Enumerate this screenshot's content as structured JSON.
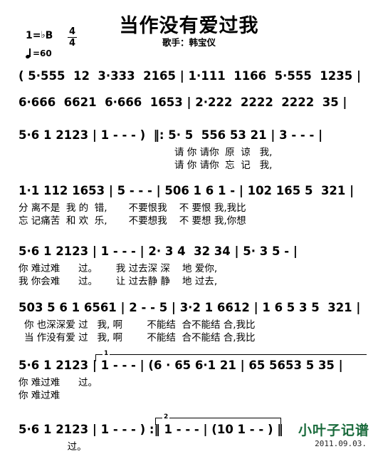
{
  "header": {
    "title": "当作没有爱过我",
    "artist": "歌手：韩宝仪",
    "key_label": "1=",
    "key_flat": "♭",
    "key_note": "B",
    "time_numerator": "4",
    "time_denominator": "4",
    "tempo": "=60"
  },
  "footer": {
    "credit": "小叶子记谱",
    "date": "2011.09.03.",
    "credit_color": "#1a6b3c"
  },
  "endings": {
    "first": "1",
    "second": "2"
  },
  "score": {
    "lines": [
      {
        "id": "line-1",
        "notes": "( 5·555  12  3·333  2165 | 1·111  1166  5·555  1235 |",
        "lyrics_a": "",
        "lyrics_b": ""
      },
      {
        "id": "line-2",
        "notes": "6·666  6621  6·666  1653 | 2·222  2222  2222  35 |",
        "lyrics_a": "",
        "lyrics_b": ""
      },
      {
        "id": "line-3",
        "notes": "5·6 1 2123 | 1 - - - )  ‖: 5· 5  556 53 21 | 3 - - - |",
        "lyrics_a": "请 你 请你  原  谅   我,",
        "lyrics_b": "请 你 请你  忘  记   我,"
      },
      {
        "id": "line-4",
        "notes": "1·1 112 1653 | 5 - - - | 506 1 6 1 - | 102 165 5  321 |",
        "lyrics_a": "分 离不是  我 的  错,       不要恨我    不 要恨 我,我比",
        "lyrics_b": "忘 记痛苦  和 欢  乐,       不要想我    不 要想 我,你想"
      },
      {
        "id": "line-5",
        "notes": "5·6 1 2123 | 1 - - - | 2· 3 4  32 34 | 5· 3 5 - |",
        "lyrics_a": "你 难过难      过。      我 过去深 深    地 爱你,",
        "lyrics_b": "我 你会难      过。      让 过去静 静    地 过去,"
      },
      {
        "id": "line-6",
        "notes": "503 5 6 1 6561 | 2 - - 5 | 3·2 1 6612 | 1 6 5 3 5  321 |",
        "lyrics_a": "你 也深深爱 过   我, 啊        不能结  合不能结 合,我比",
        "lyrics_b": "当 作没有爱 过   我, 啊        不能结  合不能结 合,我比"
      },
      {
        "id": "line-7",
        "notes": "5·6 1 2123 | 1 - - - | (6 · 65 6·1 21 | 65 5653 5 35 |",
        "lyrics_a": "你 难过难      过。",
        "lyrics_b": "你 难过难"
      },
      {
        "id": "line-8",
        "notes": "5·6 1 2123 | 1 - - - ) :‖ 1 - - - | (10 1 - - ) ‖",
        "lyrics_a": "                过。",
        "lyrics_b": ""
      }
    ]
  }
}
